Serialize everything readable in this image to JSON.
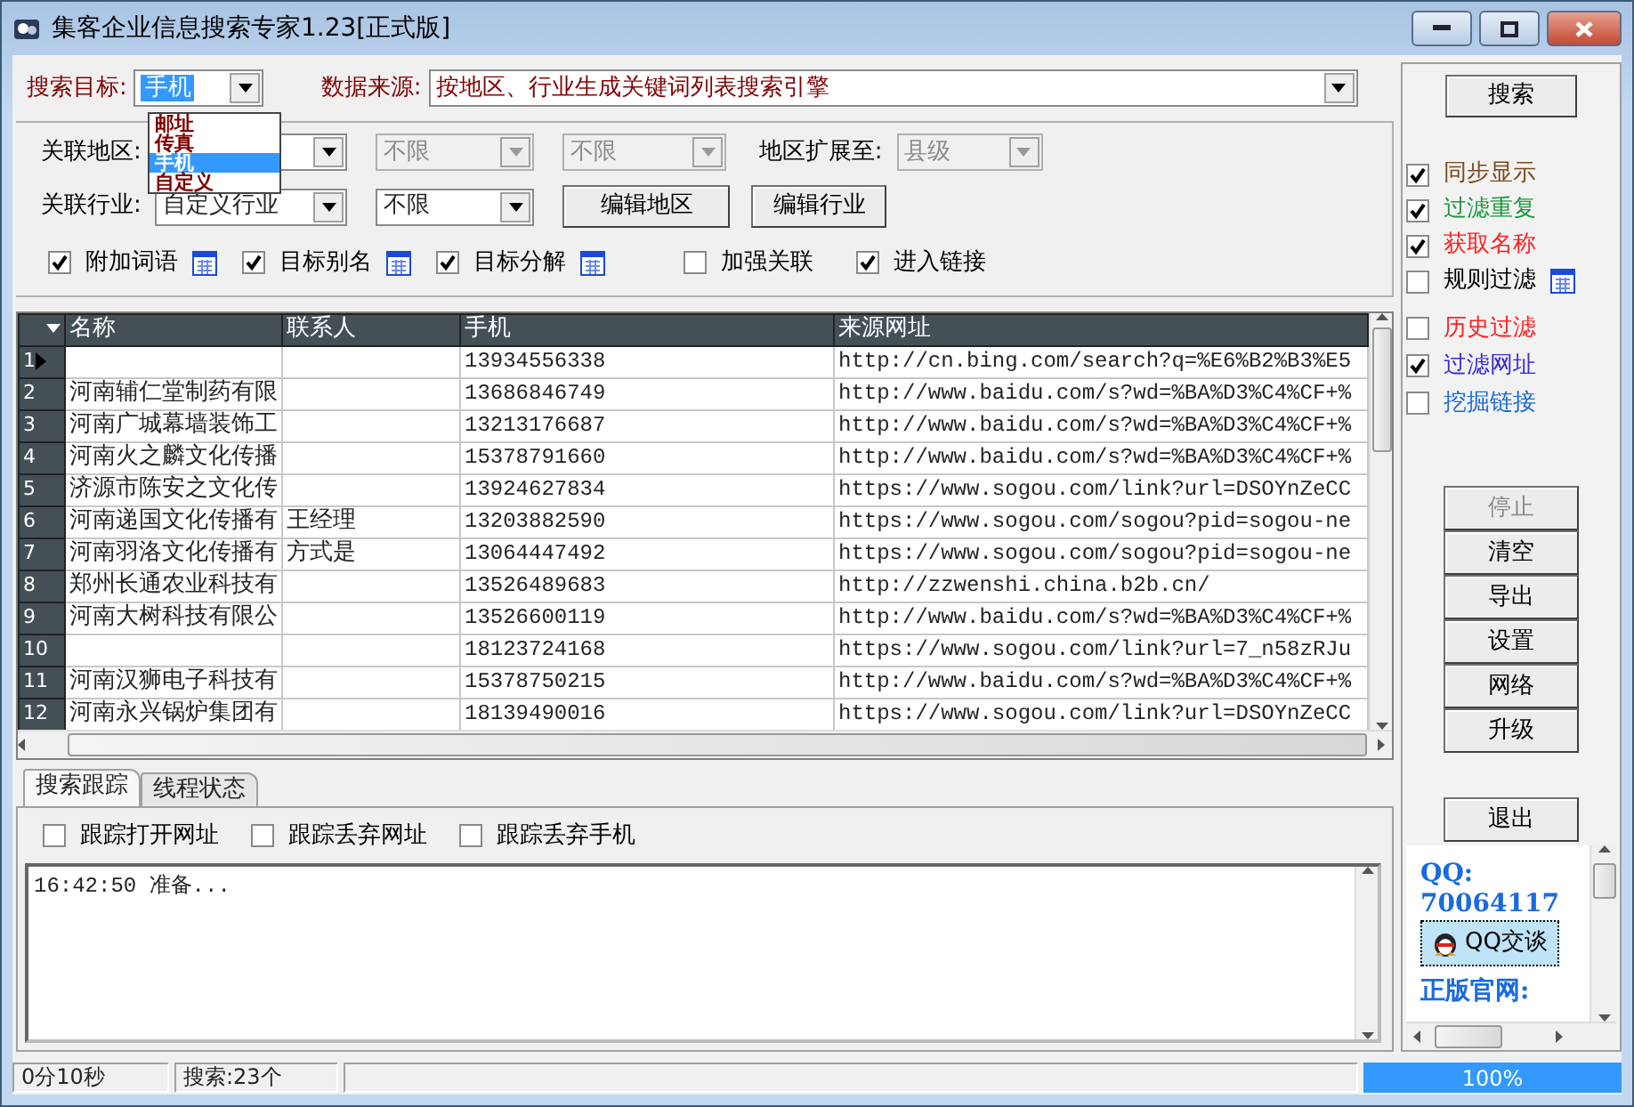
{
  "window": {
    "title": "集客企业信息搜索专家1.23[正式版]"
  },
  "search_target": {
    "label": "搜索目标:",
    "value": "手机",
    "expanded": true,
    "options": [
      {
        "label": "邮址",
        "selected": false
      },
      {
        "label": "传真",
        "selected": false
      },
      {
        "label": "手机",
        "selected": true
      },
      {
        "label": "自定义",
        "selected": false
      }
    ]
  },
  "data_source": {
    "label": "数据来源:",
    "value": "按地区、行业生成关键词列表搜索引擎"
  },
  "region_row": {
    "label": "关联地区:",
    "combos": [
      {
        "disabled": false
      },
      {
        "value": "不限",
        "disabled": true
      },
      {
        "value": "不限",
        "disabled": true
      }
    ],
    "extend_label": "地区扩展至:",
    "extend_combo": {
      "value": "县级",
      "disabled": true
    }
  },
  "industry_row": {
    "label": "关联行业:",
    "combos": [
      {
        "value": "自定义行业",
        "disabled": false
      },
      {
        "value": "不限",
        "disabled": false
      }
    ],
    "buttons": [
      "编辑地区",
      "编辑行业"
    ]
  },
  "options": [
    {
      "label": "附加词语",
      "checked": true,
      "has_icon": true
    },
    {
      "label": "目标别名",
      "checked": true,
      "has_icon": true
    },
    {
      "label": "目标分解",
      "checked": true,
      "has_icon": true
    },
    {
      "label": "加强关联",
      "checked": false,
      "has_icon": false
    },
    {
      "label": "进入链接",
      "checked": true,
      "has_icon": false
    }
  ],
  "table": {
    "columns": [
      "名称",
      "联系人",
      "手机",
      "来源网址"
    ],
    "rows": [
      {
        "number": "1",
        "current": true,
        "phone": "13934556338",
        "url": "http://cn.bing.com/search?q=%E6%B2%B3%E5"
      },
      {
        "number": "2",
        "current": false,
        "name": "河南辅仁堂制药有限",
        "phone": "13686846749",
        "url": "http://www.baidu.com/s?wd=%BA%D3%C4%CF+%"
      },
      {
        "number": "3",
        "current": false,
        "name": "河南广城幕墙装饰工",
        "phone": "13213176687",
        "url": "http://www.baidu.com/s?wd=%BA%D3%C4%CF+%"
      },
      {
        "number": "4",
        "current": false,
        "name": "河南火之麟文化传播",
        "phone": "15378791660",
        "url": "http://www.baidu.com/s?wd=%BA%D3%C4%CF+%"
      },
      {
        "number": "5",
        "current": false,
        "name": "济源市陈安之文化传",
        "phone": "13924627834",
        "url": "https://www.sogou.com/link?url=DSOYnZeCC"
      },
      {
        "number": "6",
        "current": false,
        "name": "河南递国文化传播有",
        "contact": "王经理",
        "phone": "13203882590",
        "url": "https://www.sogou.com/sogou?pid=sogou-ne"
      },
      {
        "number": "7",
        "current": false,
        "name": "河南羽洛文化传播有",
        "contact": "方式是",
        "phone": "13064447492",
        "url": "https://www.sogou.com/sogou?pid=sogou-ne"
      },
      {
        "number": "8",
        "current": false,
        "name": "郑州长通农业科技有",
        "phone": "13526489683",
        "url": "http://zzwenshi.china.b2b.cn/"
      },
      {
        "number": "9",
        "current": false,
        "name": "河南大树科技有限公",
        "phone": "13526600119",
        "url": "http://www.baidu.com/s?wd=%BA%D3%C4%CF+%"
      },
      {
        "number": "10",
        "current": false,
        "phone": "18123724168",
        "url": "https://www.sogou.com/link?url=7_n58zRJu"
      },
      {
        "number": "11",
        "current": false,
        "name": "河南汉狮电子科技有",
        "phone": "15378750215",
        "url": "http://www.baidu.com/s?wd=%BA%D3%C4%CF+%"
      },
      {
        "number": "12",
        "current": false,
        "name": "河南永兴锅炉集团有",
        "phone": "18139490016",
        "url": "https://www.sogou.com/link?url=DSOYnZeCC"
      }
    ]
  },
  "bottom_tabs": [
    {
      "label": "搜索跟踪",
      "selected": true
    },
    {
      "label": "线程状态",
      "selected": false
    }
  ],
  "trace_options": [
    {
      "label": "跟踪打开网址",
      "checked": false
    },
    {
      "label": "跟踪丢弃网址",
      "checked": false
    },
    {
      "label": "跟踪丢弃手机",
      "checked": false
    }
  ],
  "log": "16:42:50 准备...",
  "status_bar": {
    "fields": [
      "0分10秒",
      "搜索:23个"
    ],
    "progress": {
      "level": 1,
      "reading": "100%"
    }
  },
  "side": {
    "search_button": "搜索",
    "filters": [
      {
        "label": "同步显示",
        "checked": true,
        "color": "#7a4a1a",
        "has_icon": false
      },
      {
        "label": "过滤重复",
        "checked": true,
        "color": "#1a9a3a",
        "has_icon": false
      },
      {
        "label": "获取名称",
        "checked": true,
        "color": "#ff2020",
        "has_icon": false
      },
      {
        "label": "规则过滤",
        "checked": false,
        "color": "#000000",
        "has_icon": true
      },
      {
        "label": "历史过滤",
        "checked": false,
        "color": "#ff2020",
        "has_icon": false
      },
      {
        "label": "过滤网址",
        "checked": true,
        "color": "#3a2ad8",
        "has_icon": false
      },
      {
        "label": "挖掘链接",
        "checked": false,
        "color": "#1a6ad8",
        "has_icon": false
      }
    ],
    "buttons": [
      {
        "label": "停止",
        "disabled": true
      },
      {
        "label": "清空",
        "disabled": false
      },
      {
        "label": "导出",
        "disabled": false
      },
      {
        "label": "设置",
        "disabled": false
      },
      {
        "label": "网络",
        "disabled": false
      },
      {
        "label": "升级",
        "disabled": false
      }
    ],
    "exit_button": "退出",
    "qq": {
      "label": "QQ:",
      "number": "70064117",
      "chat_button": "QQ交谈",
      "site_label": "正版官网:"
    }
  }
}
